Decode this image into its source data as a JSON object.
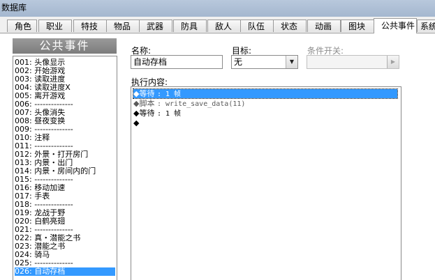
{
  "window": {
    "title": "数据库"
  },
  "tabs": [
    {
      "label": "角色",
      "active": false
    },
    {
      "label": "职业",
      "active": false
    },
    {
      "label": "特技",
      "active": false
    },
    {
      "label": "物品",
      "active": false
    },
    {
      "label": "武器",
      "active": false
    },
    {
      "label": "防具",
      "active": false
    },
    {
      "label": "敌人",
      "active": false
    },
    {
      "label": "队伍",
      "active": false
    },
    {
      "label": "状态",
      "active": false
    },
    {
      "label": "动画",
      "active": false
    },
    {
      "label": "图块",
      "active": false
    },
    {
      "label": "公共事件",
      "active": true
    },
    {
      "label": "系统",
      "active": false
    }
  ],
  "event_list": {
    "title": "公共事件",
    "items": [
      "001: 头像显示",
      "002: 开始游戏",
      "003: 读取进度",
      "004: 读取进度X",
      "005: 离开游戏",
      "006: --------------",
      "007: 头像消失",
      "008: 昼夜变换",
      "009: --------------",
      "010: 注释",
      "011: --------------",
      "012: 外景・打开房门",
      "013: 内景・出门",
      "014: 内景・房间内的门",
      "015: --------------",
      "016: 移动加速",
      "017: 手表",
      "018: --------------",
      "019: 龙战于野",
      "020: 白鹤亮翅",
      "021: --------------",
      "022: 真・潜能之书",
      "023: 潜能之书",
      "024: 骑马",
      "025: --------------",
      "026: 自动存档"
    ],
    "selected_index": 25
  },
  "form": {
    "name_label": "名称:",
    "name_value": "自动存档",
    "target_label": "目标:",
    "target_value": "无",
    "switch_label": "条件开关:",
    "switch_value": "",
    "content_label": "执行内容:"
  },
  "commands": [
    {
      "prefix": "◆等待 ",
      "text": ": 1 帧",
      "selected": true
    },
    {
      "prefix": "◆脚本 ",
      "text": ": write_save_data(11)",
      "selected": false,
      "script": true
    },
    {
      "prefix": "◆等待 ",
      "text": ": 1 帧",
      "selected": false
    },
    {
      "prefix": "◆",
      "text": "",
      "selected": false
    }
  ],
  "colors": {
    "selection": "#3399ff",
    "list_header": "#8a8a8a"
  },
  "icons": {
    "dropdown": "triangle-down",
    "dropdown_disabled": "triangle-right"
  }
}
